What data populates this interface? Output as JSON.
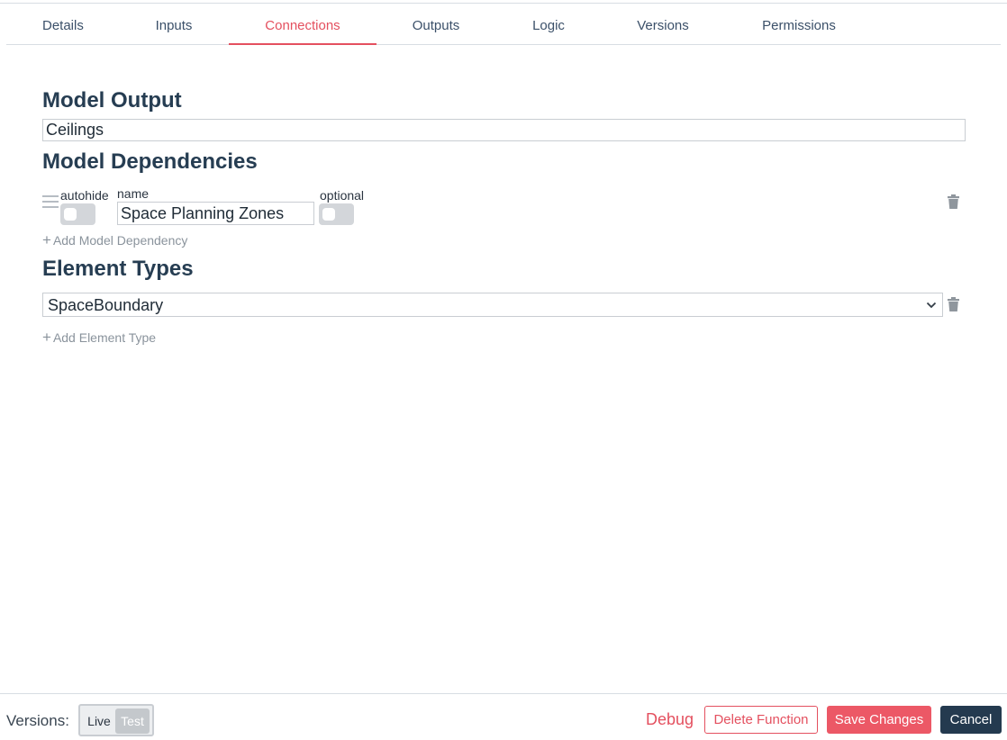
{
  "tabs": [
    {
      "label": "Details"
    },
    {
      "label": "Inputs"
    },
    {
      "label": "Connections",
      "active": true
    },
    {
      "label": "Outputs"
    },
    {
      "label": "Logic"
    },
    {
      "label": "Versions"
    },
    {
      "label": "Permissions"
    }
  ],
  "model_output": {
    "title": "Model Output",
    "value": "Ceilings"
  },
  "model_dependencies": {
    "title": "Model Dependencies",
    "items": [
      {
        "autohide_label": "autohide",
        "name_label": "name",
        "name_value": "Space Planning Zones",
        "optional_label": "optional",
        "autohide": false,
        "optional": false
      }
    ],
    "add_label": "Add Model Dependency"
  },
  "element_types": {
    "title": "Element Types",
    "items": [
      {
        "selected": "SpaceBoundary"
      }
    ],
    "add_label": "Add Element Type"
  },
  "footer": {
    "versions_label": "Versions:",
    "live_label": "Live",
    "test_label": "Test",
    "debug_label": "Debug",
    "delete_label": "Delete Function",
    "save_label": "Save Changes",
    "cancel_label": "Cancel"
  },
  "colors": {
    "accent": "#e4505f",
    "primary_dark": "#243a4f",
    "heading": "#263d52"
  },
  "icons": {
    "drag": "drag-handle-icon",
    "delete": "trash-icon",
    "add": "plus-icon",
    "select": "chevron-down-icon"
  }
}
